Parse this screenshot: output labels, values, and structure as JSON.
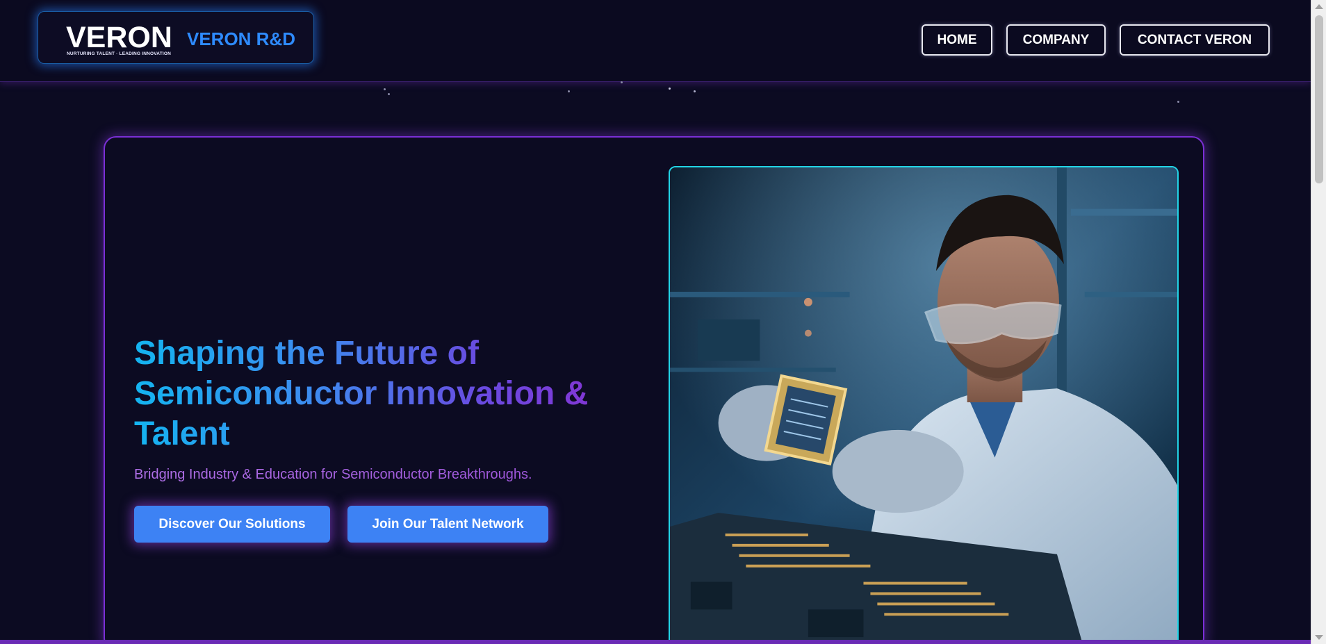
{
  "header": {
    "logo": {
      "wordmark": "VERON",
      "tagline": "NURTURING TALENT · LEADING INNOVATION"
    },
    "brand_name": "VERON R&D",
    "nav": [
      {
        "label": "HOME"
      },
      {
        "label": "COMPANY"
      },
      {
        "label": "CONTACT VERON"
      }
    ]
  },
  "hero": {
    "title": "Shaping the Future of Semiconductor Innovation & Talent",
    "subtitle": "Bridging Industry & Education for Semiconductor Breakthroughs.",
    "buttons": [
      {
        "label": "Discover Our Solutions"
      },
      {
        "label": "Join Our Talent Network"
      }
    ],
    "image": {
      "icon": "scientist-inspecting-microchip-photo"
    }
  },
  "colors": {
    "background": "#0c0b22",
    "accent_purple": "#7b2fd6",
    "accent_cyan": "#22d4e6",
    "button_blue": "#3d82f4",
    "brand_blue": "#2e8bff"
  }
}
